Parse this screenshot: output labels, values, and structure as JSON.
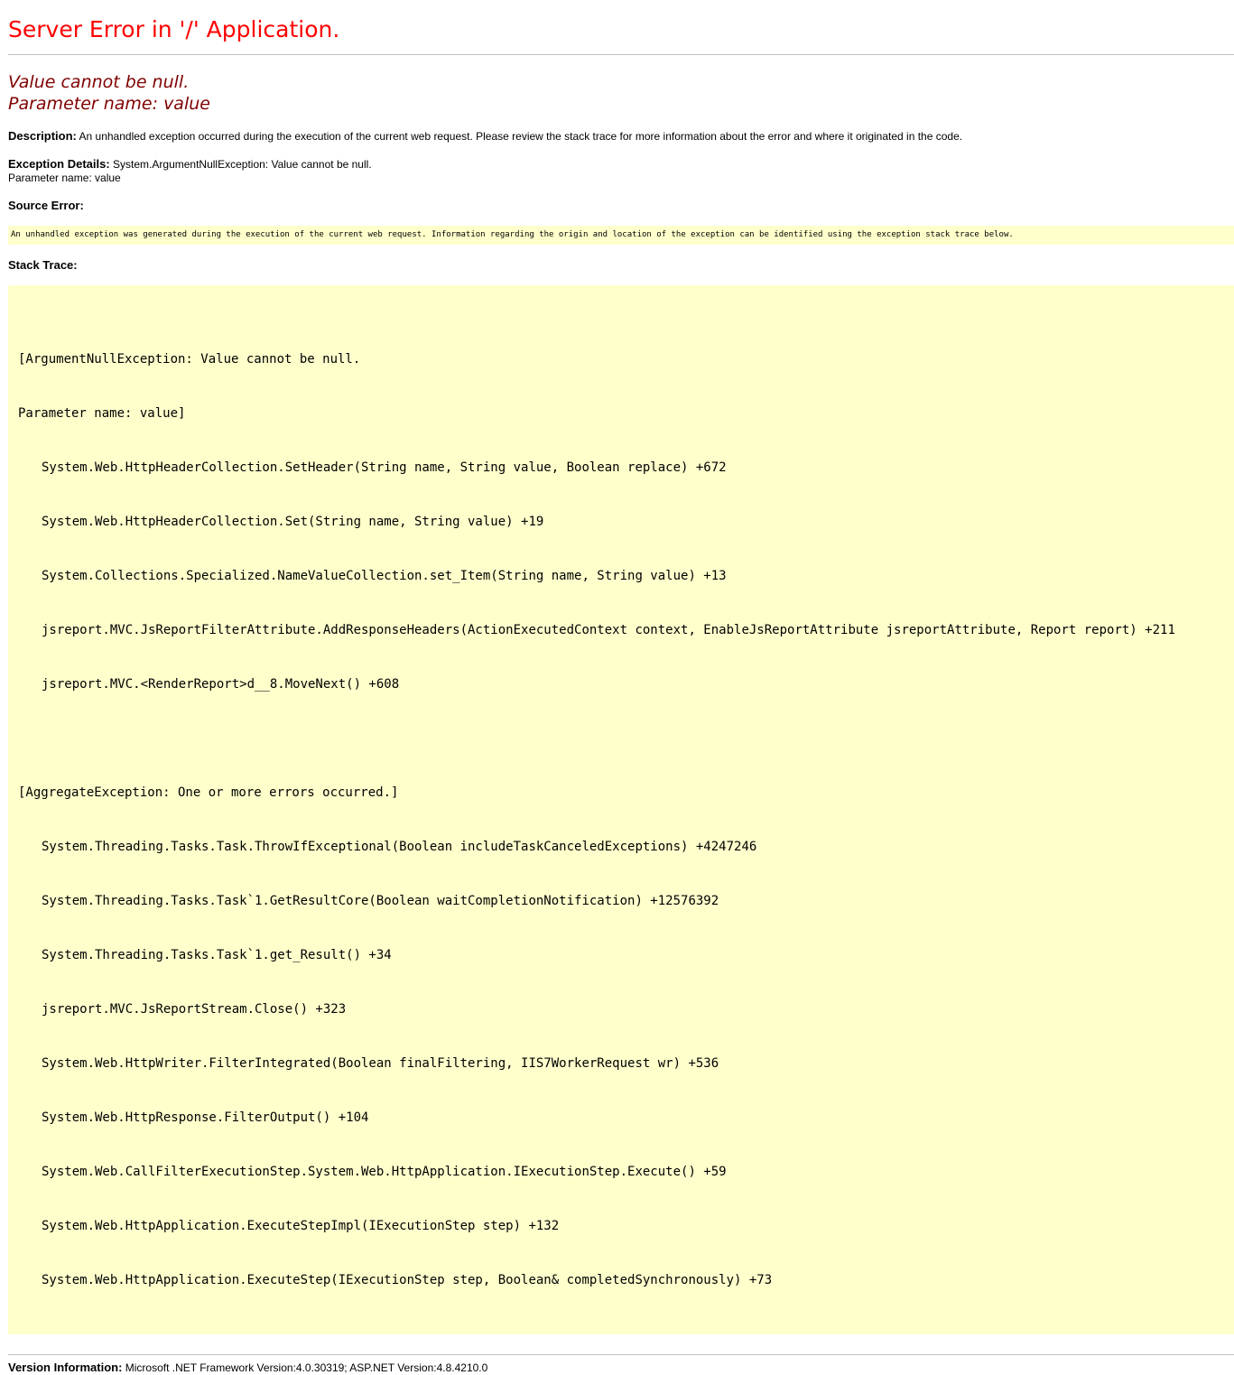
{
  "title": "Server Error in '/' Application.",
  "message": {
    "line1": "Value cannot be null.",
    "line2": "Parameter name: value"
  },
  "description": {
    "label": "Description:",
    "text": "An unhandled exception occurred during the execution of the current web request. Please review the stack trace for more information about the error and where it originated in the code."
  },
  "exception_details": {
    "label": "Exception Details:",
    "text": "System.ArgumentNullException: Value cannot be null.",
    "text2": "Parameter name: value"
  },
  "source_error": {
    "label": "Source Error:",
    "text": "An unhandled exception was generated during the execution of the current web request. Information regarding the origin and location of the exception can be identified using the exception stack trace below."
  },
  "stack_trace": {
    "label": "Stack Trace:",
    "block1": {
      "header1": "[ArgumentNullException: Value cannot be null.",
      "header2": "Parameter name: value]",
      "frames": [
        "System.Web.HttpHeaderCollection.SetHeader(String name, String value, Boolean replace) +672",
        "System.Web.HttpHeaderCollection.Set(String name, String value) +19",
        "System.Collections.Specialized.NameValueCollection.set_Item(String name, String value) +13",
        "jsreport.MVC.JsReportFilterAttribute.AddResponseHeaders(ActionExecutedContext context, EnableJsReportAttribute jsreportAttribute, Report report) +211",
        "jsreport.MVC.<RenderReport>d__8.MoveNext() +608"
      ]
    },
    "block2": {
      "header1": "[AggregateException: One or more errors occurred.]",
      "frames": [
        "System.Threading.Tasks.Task.ThrowIfExceptional(Boolean includeTaskCanceledExceptions) +4247246",
        "System.Threading.Tasks.Task`1.GetResultCore(Boolean waitCompletionNotification) +12576392",
        "System.Threading.Tasks.Task`1.get_Result() +34",
        "jsreport.MVC.JsReportStream.Close() +323",
        "System.Web.HttpWriter.FilterIntegrated(Boolean finalFiltering, IIS7WorkerRequest wr) +536",
        "System.Web.HttpResponse.FilterOutput() +104",
        "System.Web.CallFilterExecutionStep.System.Web.HttpApplication.IExecutionStep.Execute() +59",
        "System.Web.HttpApplication.ExecuteStepImpl(IExecutionStep step) +132",
        "System.Web.HttpApplication.ExecuteStep(IExecutionStep step, Boolean& completedSynchronously) +73"
      ]
    }
  },
  "version": {
    "label": "Version Information:",
    "text": "Microsoft .NET Framework Version:4.0.30319; ASP.NET Version:4.8.4210.0"
  },
  "colors": {
    "title": "#ff0000",
    "message": "#800000",
    "code_background": "#ffffcc",
    "rule": "#c0c0c0"
  }
}
